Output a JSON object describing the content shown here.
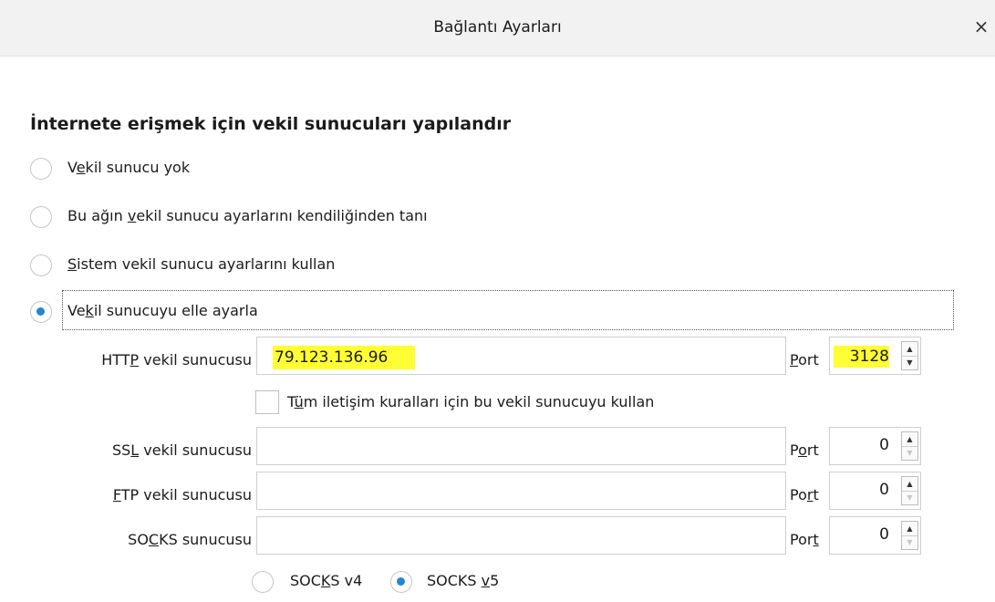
{
  "window": {
    "title": "Bağlantı Ayarları",
    "close_symbol": "×"
  },
  "section_title": "İnternete erişmek için vekil sunucuları yapılandır",
  "proxy_options": [
    {
      "pre": "V",
      "key": "e",
      "post": "kil sunucu yok",
      "checked": false
    },
    {
      "pre": "Bu ağın ",
      "key": "v",
      "post": "ekil sunucu ayarlarını kendiliğinden tanı",
      "checked": false
    },
    {
      "pre": "",
      "key": "S",
      "post": "istem vekil sunucu ayarlarını kullan",
      "checked": false
    },
    {
      "pre": "Ve",
      "key": "k",
      "post": "il sunucuyu elle ayarla",
      "checked": true
    }
  ],
  "http": {
    "label_pre": "HTT",
    "label_key": "P",
    "label_post": " vekil sunucusu",
    "value": "79.123.136.96",
    "port_label_pre": "",
    "port_label_key": "P",
    "port_label_post": "ort",
    "port_value": "3128"
  },
  "use_for_all": {
    "label_pre": "T",
    "label_key": "ü",
    "label_post": "m iletişim kuralları için bu vekil sunucuyu kullan",
    "checked": false
  },
  "ssl": {
    "label_pre": "SS",
    "label_key": "L",
    "label_post": " vekil sunucusu",
    "value": "",
    "port_label_pre": "P",
    "port_label_key": "o",
    "port_label_post": "rt",
    "port_value": "0"
  },
  "ftp": {
    "label_pre": "",
    "label_key": "F",
    "label_post": "TP vekil sunucusu",
    "value": "",
    "port_label_pre": "Po",
    "port_label_key": "r",
    "port_label_post": "t",
    "port_value": "0"
  },
  "socks": {
    "label_pre": "SO",
    "label_key": "C",
    "label_post": "KS sunucusu",
    "value": "",
    "port_label_pre": "Por",
    "port_label_key": "t",
    "port_label_post": "",
    "port_value": "0"
  },
  "socks_versions": [
    {
      "pre": "SOC",
      "key": "K",
      "post": "S v4",
      "checked": false
    },
    {
      "pre": "SOCKS ",
      "key": "v",
      "post": "5",
      "checked": true
    }
  ],
  "colors": {
    "accent": "#1e87d6",
    "highlight": "#ffff33"
  }
}
